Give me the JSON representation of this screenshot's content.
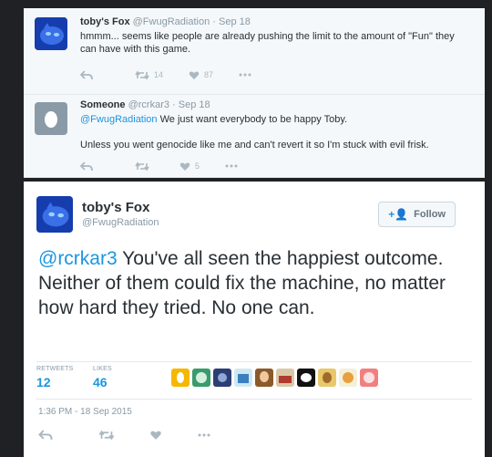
{
  "replies": [
    {
      "display_name": "toby's Fox",
      "handle": "@FwugRadiation",
      "date": "Sep 18",
      "text": "hmmm... seems like people are already pushing the limit to the amount of \"Fun\" they can have with this game.",
      "retweets": "14",
      "likes": "87",
      "avatar_icon": "fox-avatar"
    },
    {
      "display_name": "Someone",
      "handle": "@rcrkar3",
      "date": "Sep 18",
      "mention": "@FwugRadiation",
      "text_line1": " We just want everybody to be happy Toby.",
      "text_line2": "Unless you went genocide like me and can't revert it so I'm stuck with evil frisk.",
      "retweets": "",
      "likes": "5",
      "avatar_icon": "egg-avatar"
    }
  ],
  "main_tweet": {
    "display_name": "toby's Fox",
    "handle": "@FwugRadiation",
    "follow_label": "Follow",
    "mention": "@rcrkar3",
    "text": " You've all seen the happiest outcome. Neither of them could fix the machine, no matter how hard they tried. No one can.",
    "retweets_label": "RETWEETS",
    "retweets": "12",
    "likes_label": "LIKES",
    "likes": "46",
    "timestamp": "1:36 PM - 18 Sep 2015"
  },
  "colors": {
    "accent": "#1b95e0",
    "muted": "#8899a6",
    "icon": "#aab8c2",
    "text": "#292f33"
  }
}
